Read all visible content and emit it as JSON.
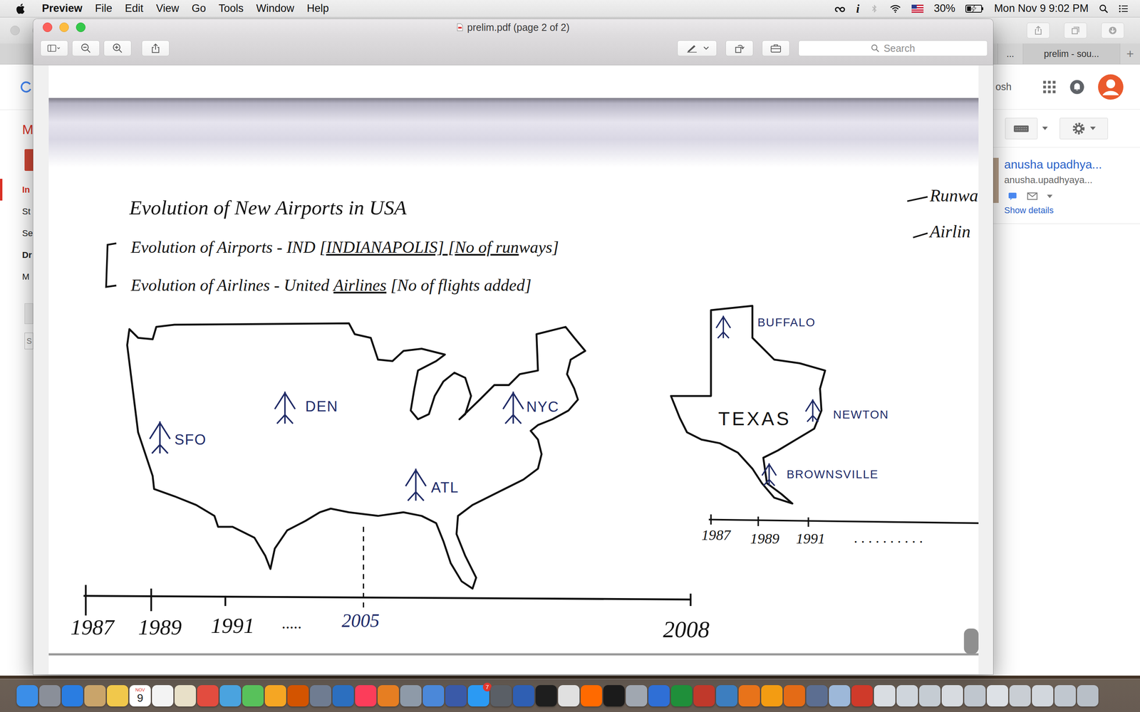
{
  "menubar": {
    "app": "Preview",
    "menus": [
      "File",
      "Edit",
      "View",
      "Go",
      "Tools",
      "Window",
      "Help"
    ],
    "status": {
      "info_glyph": "i",
      "battery": {
        "reading": "30%",
        "level": 0.3,
        "charging": true
      },
      "clock": "Mon Nov 9 9:02 PM"
    }
  },
  "browser": {
    "tabs": [
      {
        "label": "...",
        "selected": false
      },
      {
        "label": "prelim - sou...",
        "selected": true
      }
    ],
    "new_tab": "+",
    "brand": "M",
    "sidebar": [
      {
        "label": "In",
        "selected": true,
        "bold": true
      },
      {
        "label": "St",
        "selected": false,
        "bold": false
      },
      {
        "label": "Se",
        "selected": false,
        "bold": false
      },
      {
        "label": "Dr",
        "selected": false,
        "bold": true
      },
      {
        "label": "M",
        "selected": false,
        "bold": false
      }
    ],
    "search_letter": "S",
    "account": "osh",
    "contact": {
      "name": "anusha upadhya...",
      "email": "anusha.upadhyaya...",
      "link": "Show details"
    }
  },
  "window": {
    "title": "prelim.pdf (page 2 of 2)",
    "search": {
      "placeholder": "Search"
    }
  },
  "document": {
    "heading": "Evolution of New Airports in USA",
    "lines": [
      {
        "segments": [
          {
            "text": "Evolution of Airports - IND [",
            "underline": false
          },
          {
            "text": "INDIANAPOLIS] [No of run",
            "underline": true
          },
          {
            "text": "ways]",
            "underline": false
          }
        ]
      },
      {
        "segments": [
          {
            "text": "Evolution of Airlines - United ",
            "underline": false
          },
          {
            "text": "Airlines",
            "underline": true
          },
          {
            "text": " [No of flights added]",
            "underline": false
          }
        ]
      }
    ],
    "margin_notes": [
      "Runwa",
      "Airlin"
    ],
    "us_map": {
      "airports": [
        "SFO",
        "DEN",
        "NYC",
        "ATL"
      ],
      "timeline": [
        "1987",
        "1989",
        "1991",
        ".....",
        "2005",
        "2008"
      ]
    },
    "texas_map": {
      "label": "TEXAS",
      "airports": [
        "BUFFALO",
        "NEWTON",
        "BROWNSVILLE"
      ],
      "timeline": [
        "1987",
        "1989",
        "1991",
        ". . . . . . . . . ."
      ]
    }
  },
  "dock": {
    "calendar": {
      "month": "NOV",
      "day": "9"
    },
    "badge": "7"
  }
}
